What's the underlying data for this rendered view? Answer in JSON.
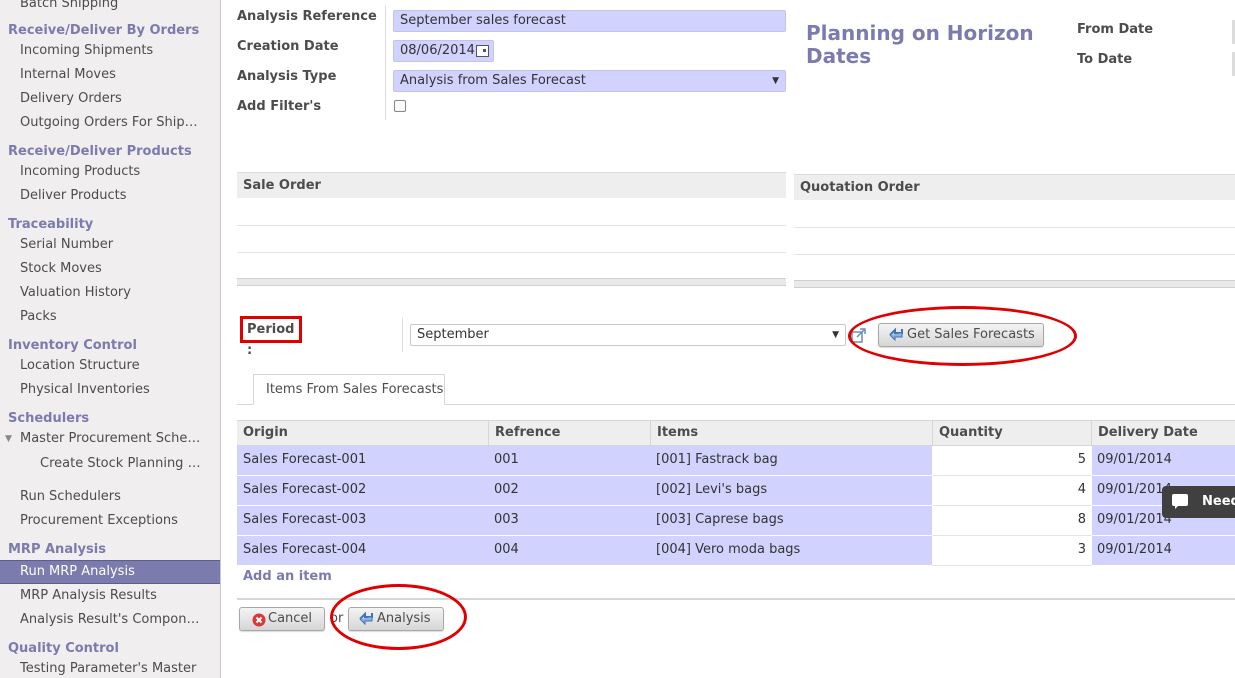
{
  "sidebar": {
    "items": [
      {
        "type": "item",
        "label": "Batch Shipping"
      },
      {
        "type": "head",
        "label": "Receive/Deliver By Orders"
      },
      {
        "type": "item",
        "label": "Incoming Shipments"
      },
      {
        "type": "item",
        "label": "Internal Moves"
      },
      {
        "type": "item",
        "label": "Delivery Orders"
      },
      {
        "type": "item",
        "label": "Outgoing Orders For Ship…"
      },
      {
        "type": "head",
        "label": "Receive/Deliver Products"
      },
      {
        "type": "item",
        "label": "Incoming Products"
      },
      {
        "type": "item",
        "label": "Deliver Products"
      },
      {
        "type": "head",
        "label": "Traceability"
      },
      {
        "type": "item",
        "label": "Serial Number"
      },
      {
        "type": "item",
        "label": "Stock Moves"
      },
      {
        "type": "item",
        "label": "Valuation History"
      },
      {
        "type": "item",
        "label": "Packs"
      },
      {
        "type": "head",
        "label": "Inventory Control"
      },
      {
        "type": "item",
        "label": "Location Structure"
      },
      {
        "type": "item",
        "label": "Physical Inventories"
      },
      {
        "type": "head",
        "label": "Schedulers"
      },
      {
        "type": "item",
        "label": "Master Procurement Sche…"
      },
      {
        "type": "item",
        "label": "Create Stock Planning …"
      },
      {
        "type": "item",
        "label": "Run Schedulers"
      },
      {
        "type": "item",
        "label": "Procurement Exceptions"
      },
      {
        "type": "head",
        "label": "MRP Analysis"
      },
      {
        "type": "item",
        "label": "Run MRP Analysis"
      },
      {
        "type": "item",
        "label": "MRP Analysis Results"
      },
      {
        "type": "item",
        "label": "Analysis Result's Compon…"
      },
      {
        "type": "head",
        "label": "Quality Control"
      },
      {
        "type": "item",
        "label": "Testing Parameter's Master"
      }
    ]
  },
  "form": {
    "analysis_reference_label": "Analysis Reference",
    "analysis_reference_value": "September sales forecast",
    "creation_date_label": "Creation Date",
    "creation_date_value": "08/06/2014",
    "analysis_type_label": "Analysis Type",
    "analysis_type_value": "Analysis from Sales Forecast",
    "add_filters_label": "Add Filter's",
    "add_filters_checked": false,
    "horizon_title": "Planning on Horizon Dates",
    "from_date_label": "From Date",
    "to_date_label": "To Date"
  },
  "sale_order": {
    "header": "Sale Order"
  },
  "quotation_order": {
    "header": "Quotation Order"
  },
  "period": {
    "label": "Period :",
    "value": "September",
    "get_button": "Get Sales Forecasts"
  },
  "tab": {
    "label": "Items From Sales Forecasts"
  },
  "items": {
    "columns": [
      "Origin",
      "Refrence",
      "Items",
      "Quantity",
      "Delivery Date"
    ],
    "rows": [
      {
        "origin": "Sales Forecast-001",
        "ref": "001",
        "item": "[001] Fastrack bag",
        "qty": "5",
        "date": "09/01/2014"
      },
      {
        "origin": "Sales Forecast-002",
        "ref": "002",
        "item": "[002] Levi's bags",
        "qty": "4",
        "date": "09/01/2014"
      },
      {
        "origin": "Sales Forecast-003",
        "ref": "003",
        "item": "[003] Caprese bags",
        "qty": "8",
        "date": "09/01/2014"
      },
      {
        "origin": "Sales Forecast-004",
        "ref": "004",
        "item": "[004] Vero moda bags",
        "qty": "3",
        "date": "09/01/2014"
      }
    ],
    "add_item": "Add an item"
  },
  "footer": {
    "cancel_label": "Cancel",
    "or_label": "or",
    "analysis_label": "Analysis"
  },
  "chat": {
    "label": "Need"
  },
  "colors": {
    "accent": "#7c7bad",
    "field_bg": "#d2d2ff",
    "annotation_red": "#e00000"
  }
}
